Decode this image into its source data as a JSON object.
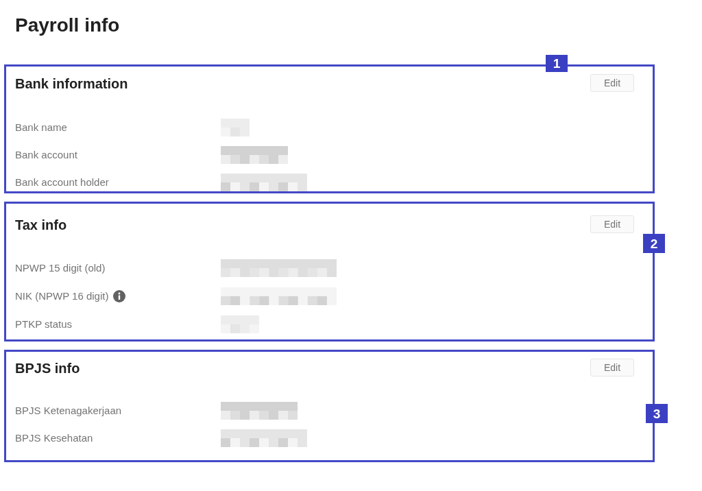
{
  "page_title": "Payroll info",
  "sections": [
    {
      "title": "Bank information",
      "edit_button": "Edit",
      "annotation": {
        "label": "1"
      },
      "rows": [
        {
          "label": "Bank name",
          "value_blurred": true
        },
        {
          "label": "Bank account",
          "value_blurred": true
        },
        {
          "label": "Bank account holder",
          "value_blurred": true
        }
      ]
    },
    {
      "title": "Tax info",
      "edit_button": "Edit",
      "annotation": {
        "label": "2"
      },
      "rows": [
        {
          "label": "NPWP 15 digit (old)",
          "value_blurred": true
        },
        {
          "label": "NIK (NPWP 16 digit)",
          "info_icon": true,
          "value_blurred": true
        },
        {
          "label": "PTKP status",
          "value_blurred": true
        }
      ]
    },
    {
      "title": "BPJS info",
      "edit_button": "Edit",
      "annotation": {
        "label": "3"
      },
      "rows": [
        {
          "label": "BPJS Ketenagakerjaan",
          "value_blurred": true
        },
        {
          "label": "BPJS Kesehatan",
          "value_blurred": true
        }
      ]
    }
  ]
}
